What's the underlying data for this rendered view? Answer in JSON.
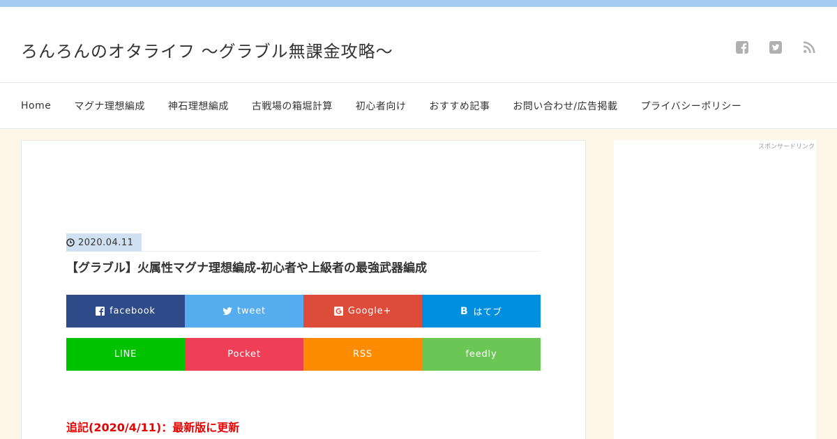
{
  "site": {
    "title": "ろんろんのオタライフ ～グラブル無課金攻略～"
  },
  "header_icons": [
    "facebook-icon",
    "twitter-icon",
    "rss-icon"
  ],
  "nav": {
    "items": [
      "Home",
      "マグナ理想編成",
      "神石理想編成",
      "古戦場の箱堀計算",
      "初心者向け",
      "おすすめ記事",
      "お問い合わせ/広告掲載",
      "プライバシーポリシー"
    ]
  },
  "post": {
    "date": "2020.04.11",
    "title": "【グラブル】火属性マグナ理想編成-初心者や上級者の最強武器編成",
    "update_note": "追記(2020/4/11)：最新版に更新"
  },
  "share": {
    "row1": [
      {
        "label": "facebook",
        "icon": "facebook-icon",
        "color": "#2e4a88"
      },
      {
        "label": "tweet",
        "icon": "twitter-icon",
        "color": "#55acee"
      },
      {
        "label": "Google+",
        "icon": "google-plus-icon",
        "color": "#dd4b39"
      },
      {
        "label": "はてブ",
        "icon": "hatena-icon",
        "color": "#008fde"
      }
    ],
    "row2": [
      {
        "label": "LINE",
        "color": "#00c300"
      },
      {
        "label": "Pocket",
        "color": "#ef3f56"
      },
      {
        "label": "RSS",
        "color": "#ff8b00"
      },
      {
        "label": "feedly",
        "color": "#6cc655"
      }
    ]
  },
  "sidebar": {
    "sponsor_label": "スポンサードリンク"
  },
  "colors": {
    "top_bar": "#a5cdf3",
    "background": "#fdf5e8",
    "date_badge": "#cfe0f3",
    "update_note": "#e60000"
  }
}
